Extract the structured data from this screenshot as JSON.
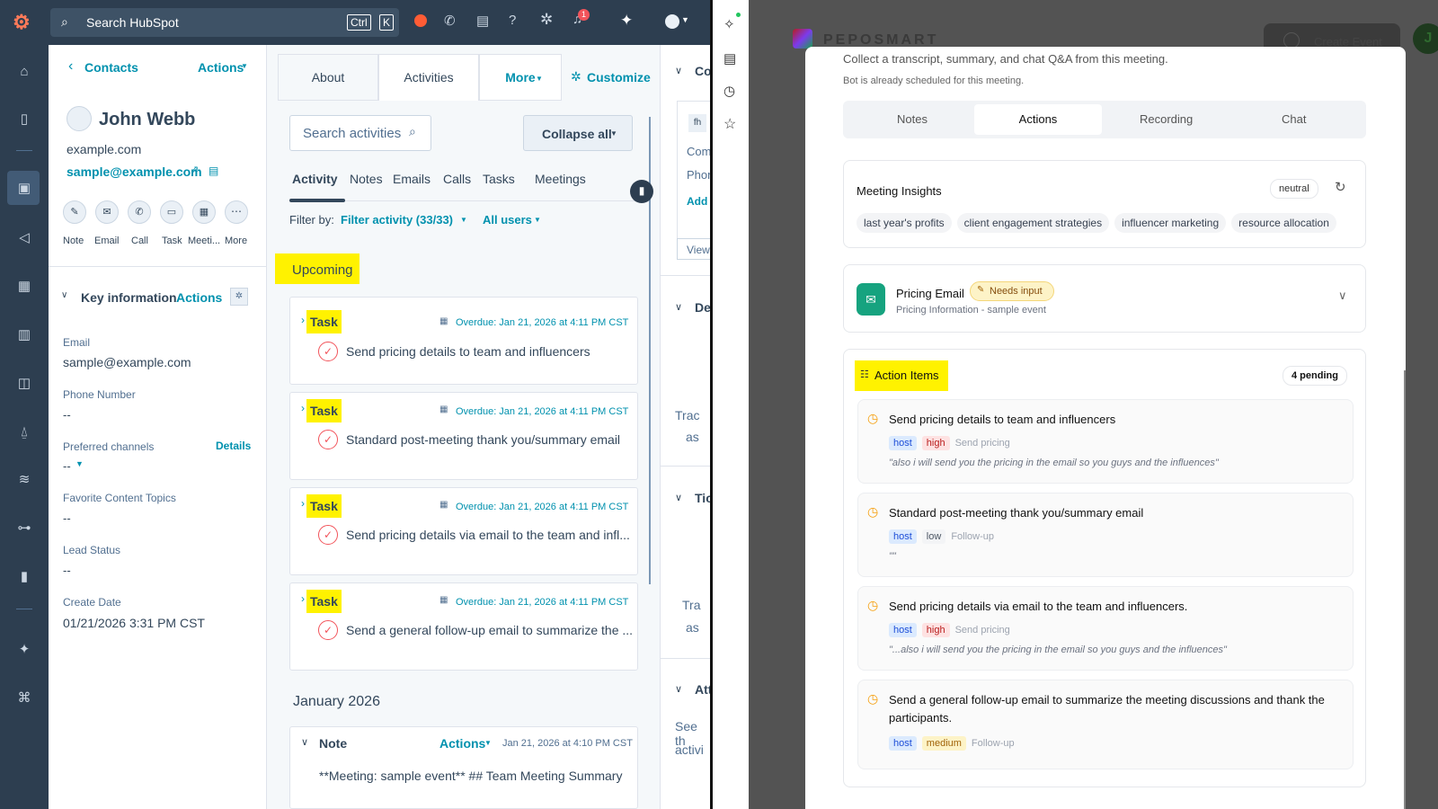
{
  "topbar": {
    "search_placeholder": "Search HubSpot",
    "kbd_ctrl": "Ctrl",
    "kbd_k": "K",
    "notif_count": "1"
  },
  "contact": {
    "back_label": "Contacts",
    "actions_label": "Actions",
    "name": "John Webb",
    "domain": "example.com",
    "email": "sample@example.com",
    "action_icons": [
      "Note",
      "Email",
      "Call",
      "Task",
      "Meeti...",
      "More"
    ]
  },
  "key_info": {
    "title": "Key information",
    "actions": "Actions",
    "details": "Details",
    "fields": [
      {
        "label": "Email",
        "value": "sample@example.com"
      },
      {
        "label": "Phone Number",
        "value": "--"
      },
      {
        "label": "Preferred channels",
        "value": "--"
      },
      {
        "label": "Favorite Content Topics",
        "value": "--"
      },
      {
        "label": "Lead Status",
        "value": "--"
      },
      {
        "label": "Create Date",
        "value": "01/21/2026 3:31 PM CST"
      }
    ]
  },
  "tabs": {
    "about": "About",
    "activities": "Activities",
    "more": "More",
    "customize": "Customize"
  },
  "activity": {
    "search_placeholder": "Search activities",
    "collapse": "Collapse all",
    "subtabs": [
      "Activity",
      "Notes",
      "Emails",
      "Calls",
      "Tasks",
      "Meetings"
    ],
    "filter_by": "Filter by:",
    "filter_activity": "Filter activity (33/33)",
    "all_users": "All users",
    "upcoming": "Upcoming",
    "tasks": [
      {
        "type": "Task",
        "due": "Overdue: Jan 21, 2026 at 4:11 PM CST",
        "text": "Send pricing details to team and influencers"
      },
      {
        "type": "Task",
        "due": "Overdue: Jan 21, 2026 at 4:11 PM CST",
        "text": "Standard post-meeting thank you/summary email"
      },
      {
        "type": "Task",
        "due": "Overdue: Jan 21, 2026 at 4:11 PM CST",
        "text": "Send pricing details via email to the team and infl..."
      },
      {
        "type": "Task",
        "due": "Overdue: Jan 21, 2026 at 4:11 PM CST",
        "text": "Send a general follow-up email to summarize the ..."
      }
    ],
    "month": "January 2026",
    "note": {
      "type": "Note",
      "actions": "Actions",
      "date": "Jan 21, 2026 at 4:10 PM CST",
      "text": "**Meeting: sample event** ## Team Meeting Summary"
    }
  },
  "rightcol": {
    "co": "Co",
    "de": "De",
    "ti": "Tic",
    "att": "Att",
    "com": "Com",
    "phon": "Phon",
    "add": "Add",
    "view": "View",
    "trac": "Trac",
    "as1": "as",
    "tra2": "Tra",
    "as2": "as",
    "see": "See th",
    "activ": "activi"
  },
  "bot": {
    "brand": "PEPOSMART",
    "create_event": "Create Event",
    "avatar": "J",
    "intro": "Collect a transcript, summary, and chat Q&A from this meeting.",
    "scheduled": "Bot is already scheduled for this meeting.",
    "tabs": [
      "Notes",
      "Actions",
      "Recording",
      "Chat"
    ],
    "insights_title": "Meeting Insights",
    "sentiment": "neutral",
    "topics": [
      "last year's profits",
      "client engagement strategies",
      "influencer marketing",
      "resource allocation"
    ],
    "email_title": "Pricing Email",
    "needs_input": "Needs input",
    "email_sub": "Pricing Information - sample event",
    "action_title": "Action Items",
    "pending": "4 pending",
    "items": [
      {
        "title": "Send pricing details to team and influencers",
        "who": "host",
        "priority": "high",
        "cat": "Send pricing",
        "quote": "\"also i will send you the pricing in the email so you guys and the influences\""
      },
      {
        "title": "Standard post-meeting thank you/summary email",
        "who": "host",
        "priority": "low",
        "cat": "Follow-up",
        "quote": "\"\""
      },
      {
        "title": "Send pricing details via email to the team and influencers.",
        "who": "host",
        "priority": "high",
        "cat": "Send pricing",
        "quote": "\"...also i will send you the pricing in the email so you guys and the influences\""
      },
      {
        "title": "Send a general follow-up email to summarize the meeting discussions and thank the",
        "title2": "participants.",
        "who": "host",
        "priority": "medium",
        "cat": "Follow-up"
      }
    ]
  },
  "colors": {
    "hub_dark": "#2d3e50",
    "hub_link": "#0091ae",
    "highlight": "#fff200",
    "accent_green": "#16a37f"
  }
}
